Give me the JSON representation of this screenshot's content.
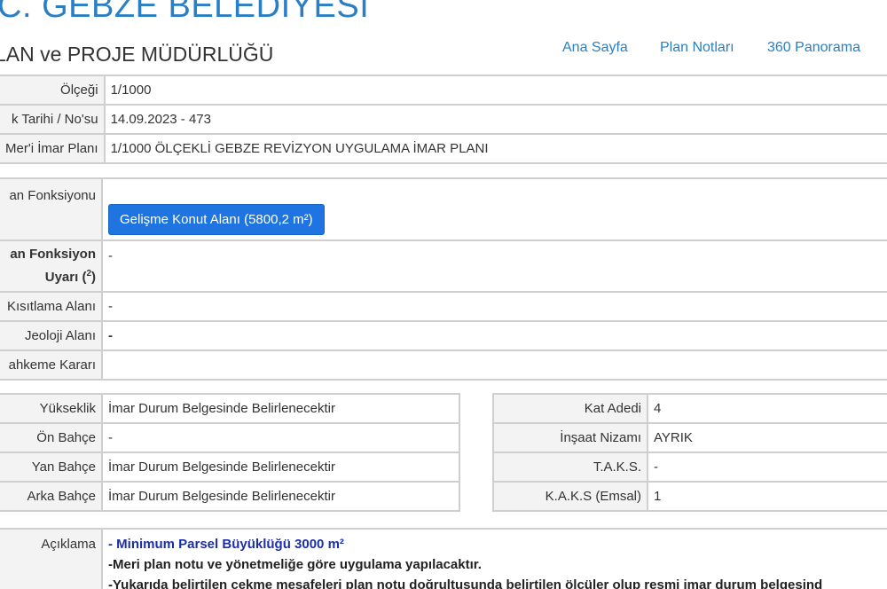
{
  "header": {
    "org_title": ".C. GEBZE BELEDİYESİ",
    "dept_title": "LAN ve PROJE MÜDÜRLÜĞÜ",
    "nav": [
      "Ana Sayfa",
      "Plan Notları",
      "360 Panorama"
    ]
  },
  "plan_info": [
    {
      "label": "Ölçeği",
      "value": "1/1000"
    },
    {
      "label": "k Tarihi / No'su",
      "value": "14.09.2023 - 473"
    },
    {
      "label": "Mer'i İmar Planı",
      "value": "1/1000 ÖLÇEKLİ GEBZE REVİZYON UYGULAMA İMAR PLANI"
    }
  ],
  "function": {
    "label": "an Fonksiyonu",
    "button": "Gelişme Konut Alanı (5800,2 m²)",
    "warning_label_1": "an Fonksiyon",
    "warning_label_2": "Uyarı (",
    "warning_sup": "2",
    "warning_label_3": ")",
    "warning_value": "-",
    "restriction_label": "Kısıtlama Alanı",
    "restriction_value": "-",
    "geology_label": "Jeoloji Alanı",
    "geology_value": "-",
    "court_label": "ahkeme Kararı",
    "court_value": ""
  },
  "left_details": [
    {
      "label": "Yükseklik",
      "value": "İmar Durum Belgesinde Belirlenecektir"
    },
    {
      "label": "Ön Bahçe",
      "value": "-"
    },
    {
      "label": "Yan Bahçe",
      "value": "İmar Durum Belgesinde Belirlenecektir"
    },
    {
      "label": "Arka Bahçe",
      "value": "İmar Durum Belgesinde Belirlenecektir"
    }
  ],
  "right_details": [
    {
      "label": "Kat Adedi",
      "value": "4"
    },
    {
      "label": "İnşaat Nizamı",
      "value": "AYRIK"
    },
    {
      "label": "T.A.K.S.",
      "value": "-"
    },
    {
      "label": "K.A.K.S (Emsal)",
      "value": "1"
    }
  ],
  "description": {
    "label": "Açıklama",
    "lines": [
      "- Minimum Parsel Büyüklüğü 3000 m²",
      "-Meri plan notu ve yönetmeliğe göre uygulama yapılacaktır.",
      "-Yukarıda belirtilen çekme mesafeleri plan notu doğrultusunda belirtilen ölçüler olup resmi imar durum belgesind"
    ]
  }
}
